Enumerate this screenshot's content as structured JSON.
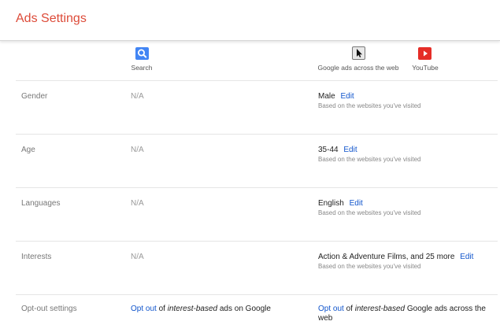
{
  "header": {
    "title": "Ads Settings"
  },
  "columns": {
    "search": {
      "label": "Search",
      "icon": "search-icon",
      "color": "#4285f4"
    },
    "web": {
      "label": "Google ads across the web",
      "icon": "cursor-icon"
    },
    "youtube": {
      "label": "YouTube",
      "icon": "youtube-play-icon",
      "color": "#e52d27"
    }
  },
  "rows": [
    {
      "label": "Gender",
      "search_value": "N/A",
      "value": "Male",
      "edit": "Edit",
      "note": "Based on the websites you've visited"
    },
    {
      "label": "Age",
      "search_value": "N/A",
      "value": "35-44",
      "edit": "Edit",
      "note": "Based on the websites you've visited"
    },
    {
      "label": "Languages",
      "search_value": "N/A",
      "value": "English",
      "edit": "Edit",
      "note": "Based on the websites you've visited"
    },
    {
      "label": "Interests",
      "search_value": "N/A",
      "value": "Action & Adventure Films, and 25 more",
      "edit": "Edit",
      "note": "Based on the websites you've visited"
    }
  ],
  "optout": {
    "label": "Opt-out settings",
    "search_link": "Opt out",
    "search_of": " of ",
    "search_em": "interest-based",
    "search_rest": " ads on Google",
    "web_link": "Opt out",
    "web_of": " of ",
    "web_em": "interest-based",
    "web_rest": " Google ads across the web"
  },
  "colors": {
    "title": "#dd4b39",
    "link": "#1155cc"
  }
}
